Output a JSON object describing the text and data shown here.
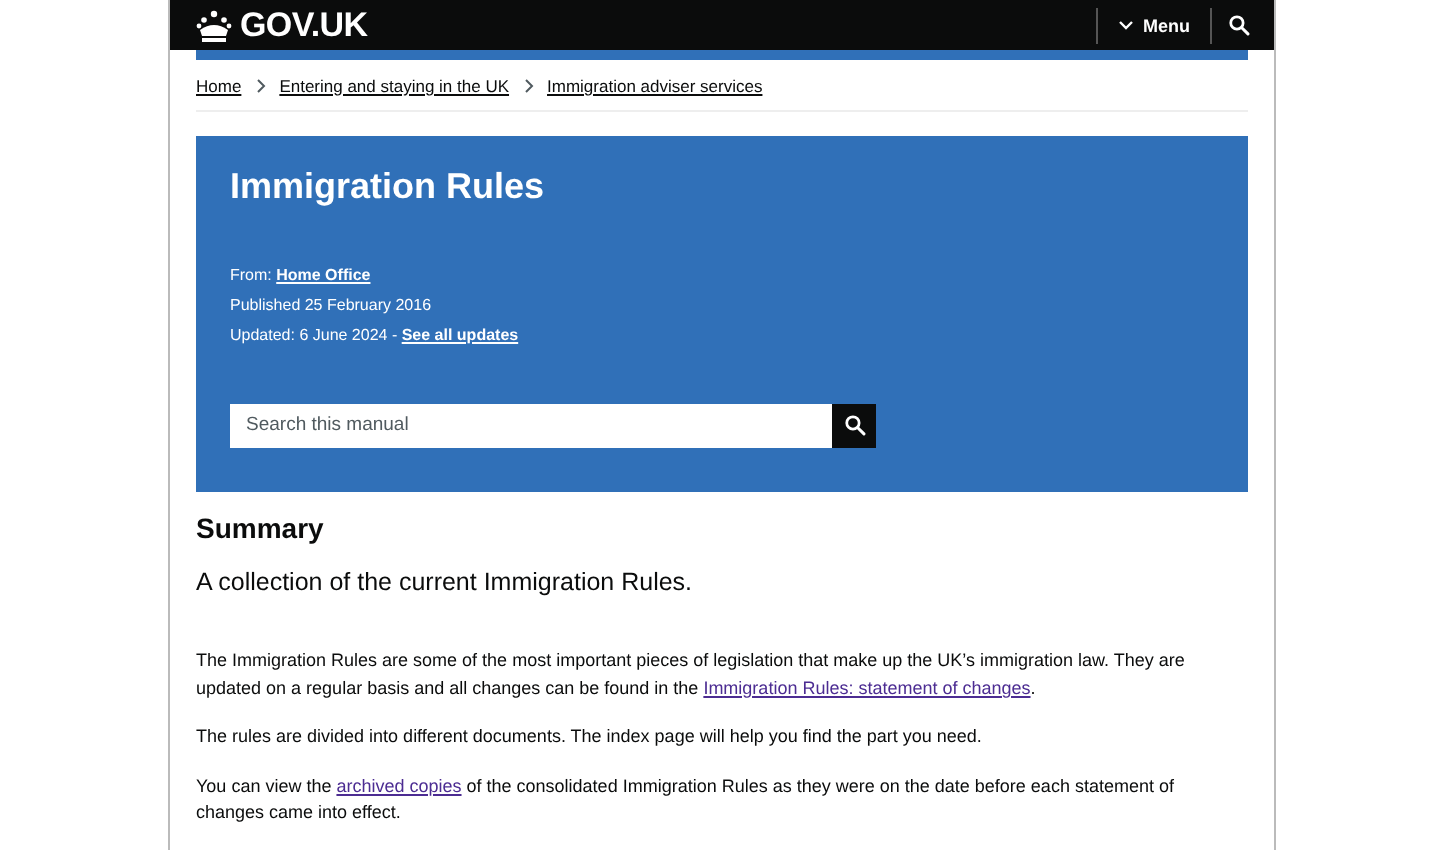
{
  "header": {
    "logo": "GOV.UK",
    "menu": "Menu"
  },
  "breadcrumbs": [
    "Home",
    "Entering and staying in the UK",
    "Immigration adviser services"
  ],
  "hero": {
    "title": "Immigration Rules",
    "meta": [
      [
        {
          "text": "From: ",
          "kind": "text"
        },
        {
          "text": "Home Office",
          "kind": "link"
        }
      ],
      [
        {
          "text": "Published 25 February 2016",
          "kind": "text"
        }
      ],
      [
        {
          "text": "Updated: 6 June 2024 - ",
          "kind": "text"
        },
        {
          "text": "See all updates",
          "kind": "link"
        }
      ]
    ],
    "search": {
      "placeholder": "Search this manual"
    }
  },
  "summary": {
    "heading": "Summary",
    "lead": "A collection of the current Immigration Rules.",
    "paragraphs": [
      [
        {
          "text": "The Immigration Rules are some of the most important pieces of legislation that make up the UK’s immigration law. They are updated on a regular basis and all changes can be found in the ",
          "kind": "text"
        },
        {
          "text": "Immigration Rules: statement of changes",
          "kind": "link"
        },
        {
          "text": ".",
          "kind": "text"
        }
      ],
      [
        {
          "text": "The rules are divided into different documents. The index page will help you find the part you need.",
          "kind": "text"
        }
      ],
      [
        {
          "text": "You can view the ",
          "kind": "text"
        },
        {
          "text": "archived copies",
          "kind": "link"
        },
        {
          "text": " of the consolidated Immigration Rules as they were on the date before each statement of changes came into effect.",
          "kind": "text"
        }
      ]
    ]
  }
}
